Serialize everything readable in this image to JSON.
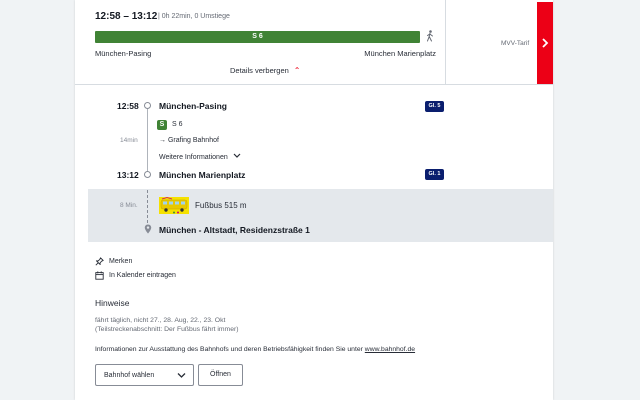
{
  "summary": {
    "time_range": "12:58 – 13:12",
    "duration_info": "| 0h 22min, 0 Umstiege",
    "line_bar_label": "S 6",
    "from": "München-Pasing",
    "to": "München Marienplatz",
    "details_toggle": "Details verbergen",
    "tariff": "MVV-Tarif"
  },
  "timeline": {
    "departure": {
      "time": "12:58",
      "stop": "München-Pasing",
      "platform": "Gl. 5"
    },
    "line": {
      "badge": "S",
      "name": "S 6",
      "direction": "→ Grafing Bahnhof",
      "duration": "14min",
      "more_info": "Weitere Informationen"
    },
    "arrival": {
      "time": "13:12",
      "stop": "München Marienplatz",
      "platform": "Gl. 1"
    },
    "walk": {
      "duration": "8 Min.",
      "text": "Fußbus 515 m"
    },
    "destination": "München - Altstadt, Residenzstraße 1"
  },
  "actions": {
    "bookmark": "Merken",
    "calendar": "In Kalender eintragen"
  },
  "notes": {
    "title": "Hinweise",
    "line1": "fährt täglich, nicht 27., 28. Aug, 22., 23. Okt",
    "line2": "(Teilstreckenabschnitt: Der Fußbus fährt immer)",
    "info_prefix": "Informationen zur Ausstattung des Bahnhofs und deren Betriebsfähigkeit finden Sie unter ",
    "info_link": "www.bahnhof.de"
  },
  "station_select": {
    "placeholder": "Bahnhof wählen",
    "open_label": "Öffnen"
  },
  "colors": {
    "accent_red": "#ec0016",
    "s_bahn_green": "#408335",
    "platform_navy": "#0a1e6e"
  }
}
